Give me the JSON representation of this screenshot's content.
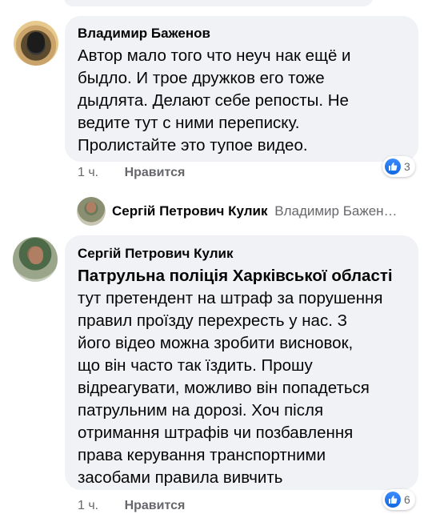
{
  "comments": [
    {
      "author": "Владимир Баженов",
      "lines": [
        "Автор мало того что неуч нак ещё и",
        "быдло. И трое дружков его тоже",
        "дыдлята. Делают себе репосты. Не",
        "ведите тут с ними переписку.",
        "Пролистайте это тупое видео."
      ],
      "time": "1 ч.",
      "like_label": "Нравится",
      "reaction_count": "3"
    },
    {
      "author": "Сергій Петрович Кулик",
      "mention": "Патрульна поліція Харківської області",
      "lines": [
        "тут претендент на штраф за порушення",
        "правил проїзду перехресть у нас. З",
        "його відео можна зробити висновок,",
        "що він часто так їздить. Прошу",
        "відреагувати, можливо він попадеться",
        "патрульним на дорозі. Хоч після",
        "отримання штрафів чи позбавлення",
        "права керування транспортними",
        "засобами правила вивчить"
      ],
      "time": "1 ч.",
      "like_label": "Нравится",
      "reaction_count": "6"
    }
  ],
  "reply_preview": {
    "author": "Сергій Петрович Кулик",
    "snippet": "Владимир Бажен…"
  },
  "colors": {
    "bubble": "#f0f2f5",
    "meta_text": "#65676b",
    "like_blue": "#1877f2"
  }
}
